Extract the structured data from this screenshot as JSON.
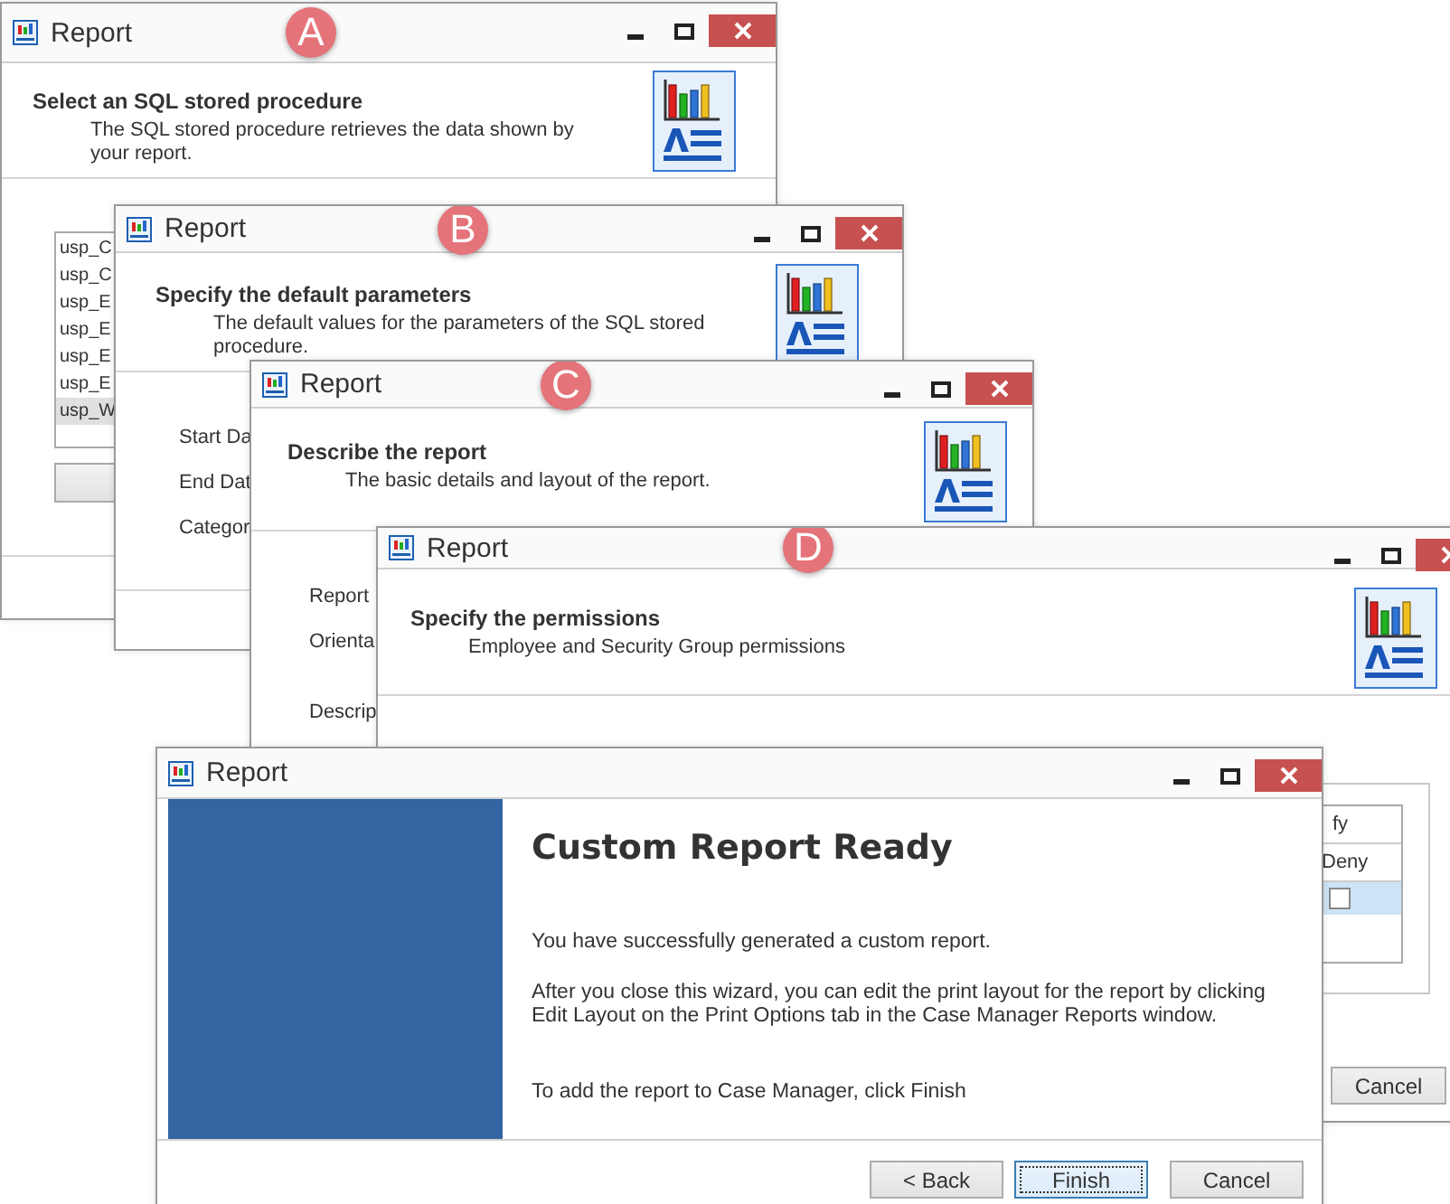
{
  "windows": [
    {
      "title": "Report",
      "badge": "A",
      "heading": "Select an SQL stored procedure",
      "description": "The SQL stored procedure retrieves the data shown by your report.",
      "procedures": [
        {
          "name": "usp_C",
          "selected": false
        },
        {
          "name": "usp_C",
          "selected": false
        },
        {
          "name": "usp_E",
          "selected": false
        },
        {
          "name": "usp_E",
          "selected": false
        },
        {
          "name": "usp_E",
          "selected": false
        },
        {
          "name": "usp_E",
          "selected": false
        },
        {
          "name": "usp_W",
          "selected": true
        }
      ]
    },
    {
      "title": "Report",
      "badge": "B",
      "heading": "Specify the default parameters",
      "description": "The default values for the parameters of the SQL stored procedure.",
      "fields": [
        "Start Da",
        "End Dat",
        "Categor"
      ]
    },
    {
      "title": "Report",
      "badge": "C",
      "heading": "Describe the report",
      "description": "The basic details and layout of the report.",
      "fields": [
        "Report",
        "Orienta",
        "Descrip"
      ]
    },
    {
      "title": "Report",
      "badge": "D",
      "heading": "Specify the permissions",
      "description": "Employee and Security Group permissions",
      "permissions": {
        "group_header": "fy",
        "column": "Deny",
        "rows": [
          {
            "checked": false,
            "selected": true
          }
        ]
      },
      "buttons": [
        "Cancel"
      ]
    }
  ],
  "final": {
    "title": "Report",
    "heading": "Custom Report Ready",
    "paragraphs": [
      "You have successfully generated a custom report.",
      "After you close this wizard, you can edit the print layout for the report by clicking Edit Layout on the Print Options tab in the Case Manager Reports window.",
      "To add the report to Case Manager, click Finish"
    ],
    "buttons": [
      {
        "label": "< Back",
        "focused": false
      },
      {
        "label": "Finish",
        "focused": true
      },
      {
        "label": "Cancel",
        "focused": false
      }
    ]
  }
}
